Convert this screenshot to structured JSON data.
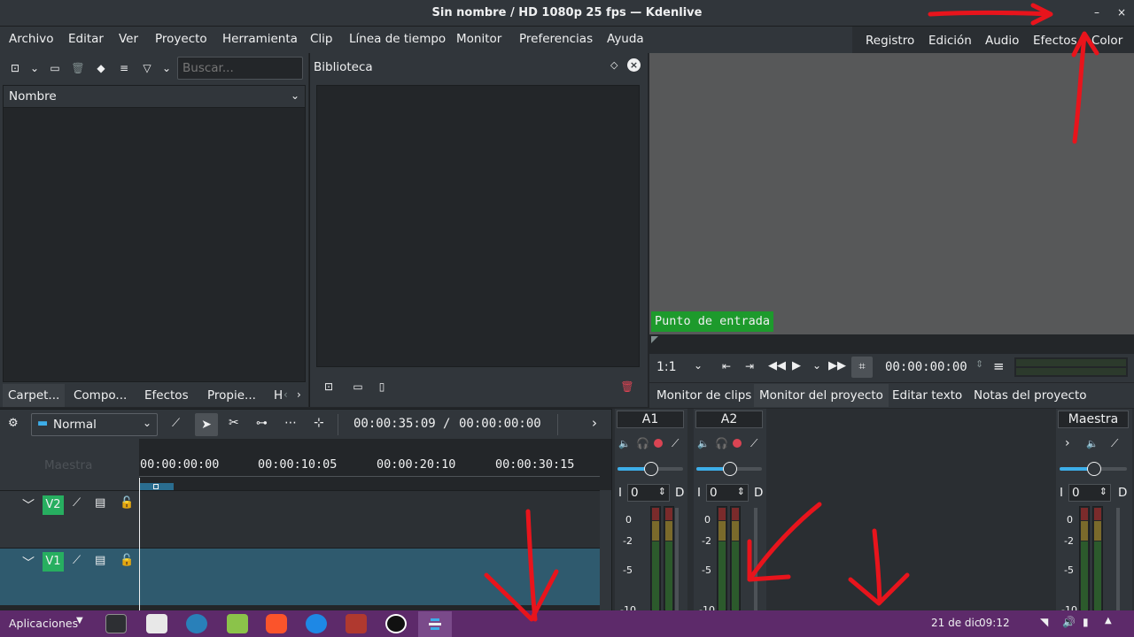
{
  "window": {
    "title": "Sin nombre / HD 1080p 25 fps — Kdenlive",
    "minimize_glyph": "–",
    "close_glyph": "×"
  },
  "menu": [
    "Archivo",
    "Editar",
    "Ver",
    "Proyecto",
    "Herramienta",
    "Clip",
    "Línea de tiempo",
    "Monitor",
    "Preferencias",
    "Ayuda"
  ],
  "layouts": [
    "Registro",
    "Edición",
    "Audio",
    "Efectos",
    "Color"
  ],
  "bin": {
    "search_placeholder": "Buscar...",
    "column_header": "Nombre"
  },
  "library": {
    "title": "Biblioteca"
  },
  "left_tabs": [
    "Carpet...",
    "Compo...",
    "Efectos",
    "Propie...",
    "H"
  ],
  "monitor": {
    "in_point_label": "Punto de entrada",
    "zoom": "1:1",
    "timecode": "00:00:00:00"
  },
  "monitor_tabs": [
    "Monitor de clips",
    "Monitor del proyecto",
    "Editar texto",
    "Notas del proyecto"
  ],
  "timeline_toolbar": {
    "mode": "Normal",
    "position": "00:00:35:09",
    "duration": "00:00:00:00",
    "separator": "/"
  },
  "timeline": {
    "master_label": "Maestra",
    "ruler": [
      "00:00:00:00",
      "00:00:10:05",
      "00:00:20:10",
      "00:00:30:15"
    ],
    "tracks": [
      {
        "name": "V2"
      },
      {
        "name": "V1"
      }
    ]
  },
  "mixer": {
    "strips": [
      {
        "name": "A1",
        "gain": "0",
        "left": "I",
        "right": "D"
      },
      {
        "name": "A2",
        "gain": "0",
        "left": "I",
        "right": "D"
      }
    ],
    "master": {
      "name": "Maestra",
      "gain": "0",
      "left": "I",
      "right": "D"
    },
    "scale": [
      "0",
      "-2",
      "-5",
      "-10"
    ]
  },
  "taskbar": {
    "apps_label": "Aplicaciones",
    "date": "21 de dic",
    "time": "09:12"
  },
  "colors": {
    "accent": "#3daee9",
    "in_point_bg": "#1d9a2c",
    "track_label": "#27ae60",
    "annotation": "#e8141c",
    "taskbar": "#5d2a6a"
  }
}
